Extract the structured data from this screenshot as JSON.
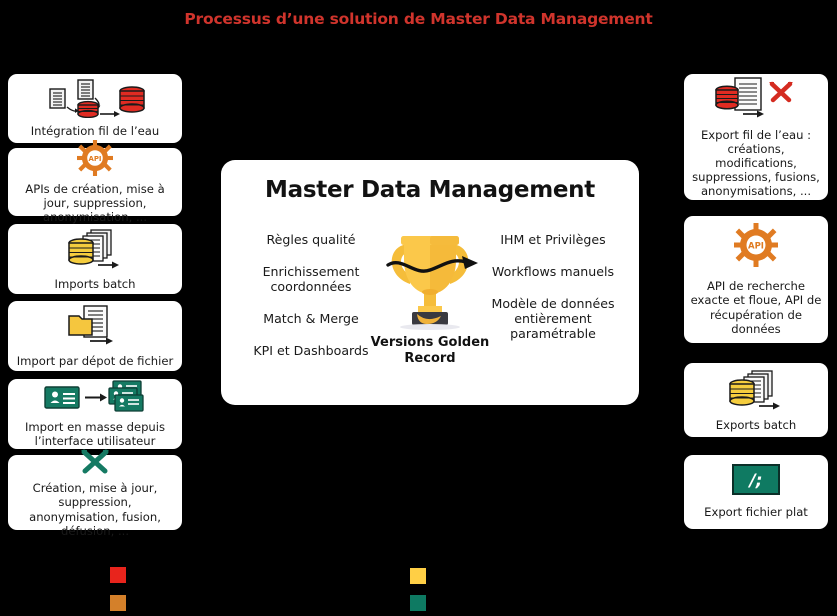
{
  "title": "Processus d’une solution de Master Data Management",
  "colors": {
    "title_red": "#d0342c",
    "red": "#e8241c",
    "orange": "#d4802a",
    "yellow": "#ffcf45",
    "teal": "#0e7a62",
    "card_bg": "#ffffff",
    "background": "#000000"
  },
  "left_cards": [
    {
      "icon": "database-stream-icon",
      "label": "Intégration fil de l’eau"
    },
    {
      "icon": "api-gear-icon",
      "label": "APIs de création, mise à jour, suppression, anonymisation, ..."
    },
    {
      "icon": "database-documents-icon",
      "label": "Imports batch"
    },
    {
      "icon": "folder-document-icon",
      "label": "Import par dépot de fichier"
    },
    {
      "icon": "user-cards-icon",
      "label": "Import en masse depuis l’interface utilisateur"
    },
    {
      "icon": "tools-icon",
      "label": "Création, mise à jour, suppression, anonymisation, fusion, défusion, ..."
    }
  ],
  "right_cards": [
    {
      "icon": "database-document-tools-icon",
      "label": "Export fil de l’eau : créations, modifications, suppressions, fusions, anonymisations, ..."
    },
    {
      "icon": "api-gear-icon",
      "label": "API de recherche exacte et floue, API de récupération de données"
    },
    {
      "icon": "database-documents-icon",
      "label": "Exports batch"
    },
    {
      "icon": "flat-file-icon",
      "label": "Export fichier plat"
    }
  ],
  "center": {
    "title": "Master Data Management",
    "left_items": [
      "Règles qualité",
      "Enrichissement coordonnées",
      "Match & Merge",
      "KPI et Dashboards"
    ],
    "right_items": [
      "IHM et Privilèges",
      "Workflows manuels",
      "Modèle de données entièrement paramétrable"
    ],
    "trophy_icon": "trophy-icon",
    "trophy_caption": "Versions Golden Record"
  },
  "legend_swatches": [
    {
      "name": "swatch-red",
      "color": "#e8241c"
    },
    {
      "name": "swatch-orange",
      "color": "#d4802a"
    },
    {
      "name": "swatch-yellow",
      "color": "#ffcf45"
    },
    {
      "name": "swatch-teal",
      "color": "#0e7a62"
    }
  ]
}
